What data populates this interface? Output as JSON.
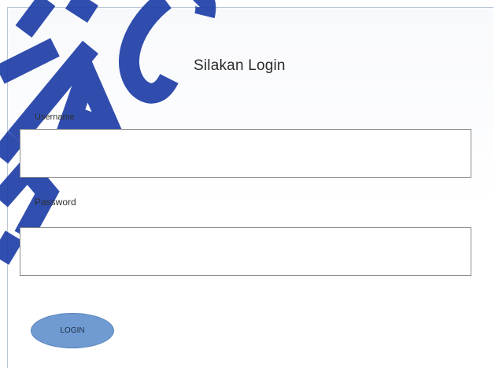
{
  "page": {
    "title": "Silakan Login"
  },
  "form": {
    "username": {
      "label": "Username",
      "value": "",
      "placeholder": ""
    },
    "password": {
      "label": "Password",
      "value": "",
      "placeholder": ""
    },
    "login_label": "LOGIN"
  },
  "watermark": {
    "text": "K   N  TAG S"
  },
  "colors": {
    "button_fill": "#6f9bd2",
    "field_border": "#8a8a8a",
    "watermark": "#1f3fa8"
  }
}
